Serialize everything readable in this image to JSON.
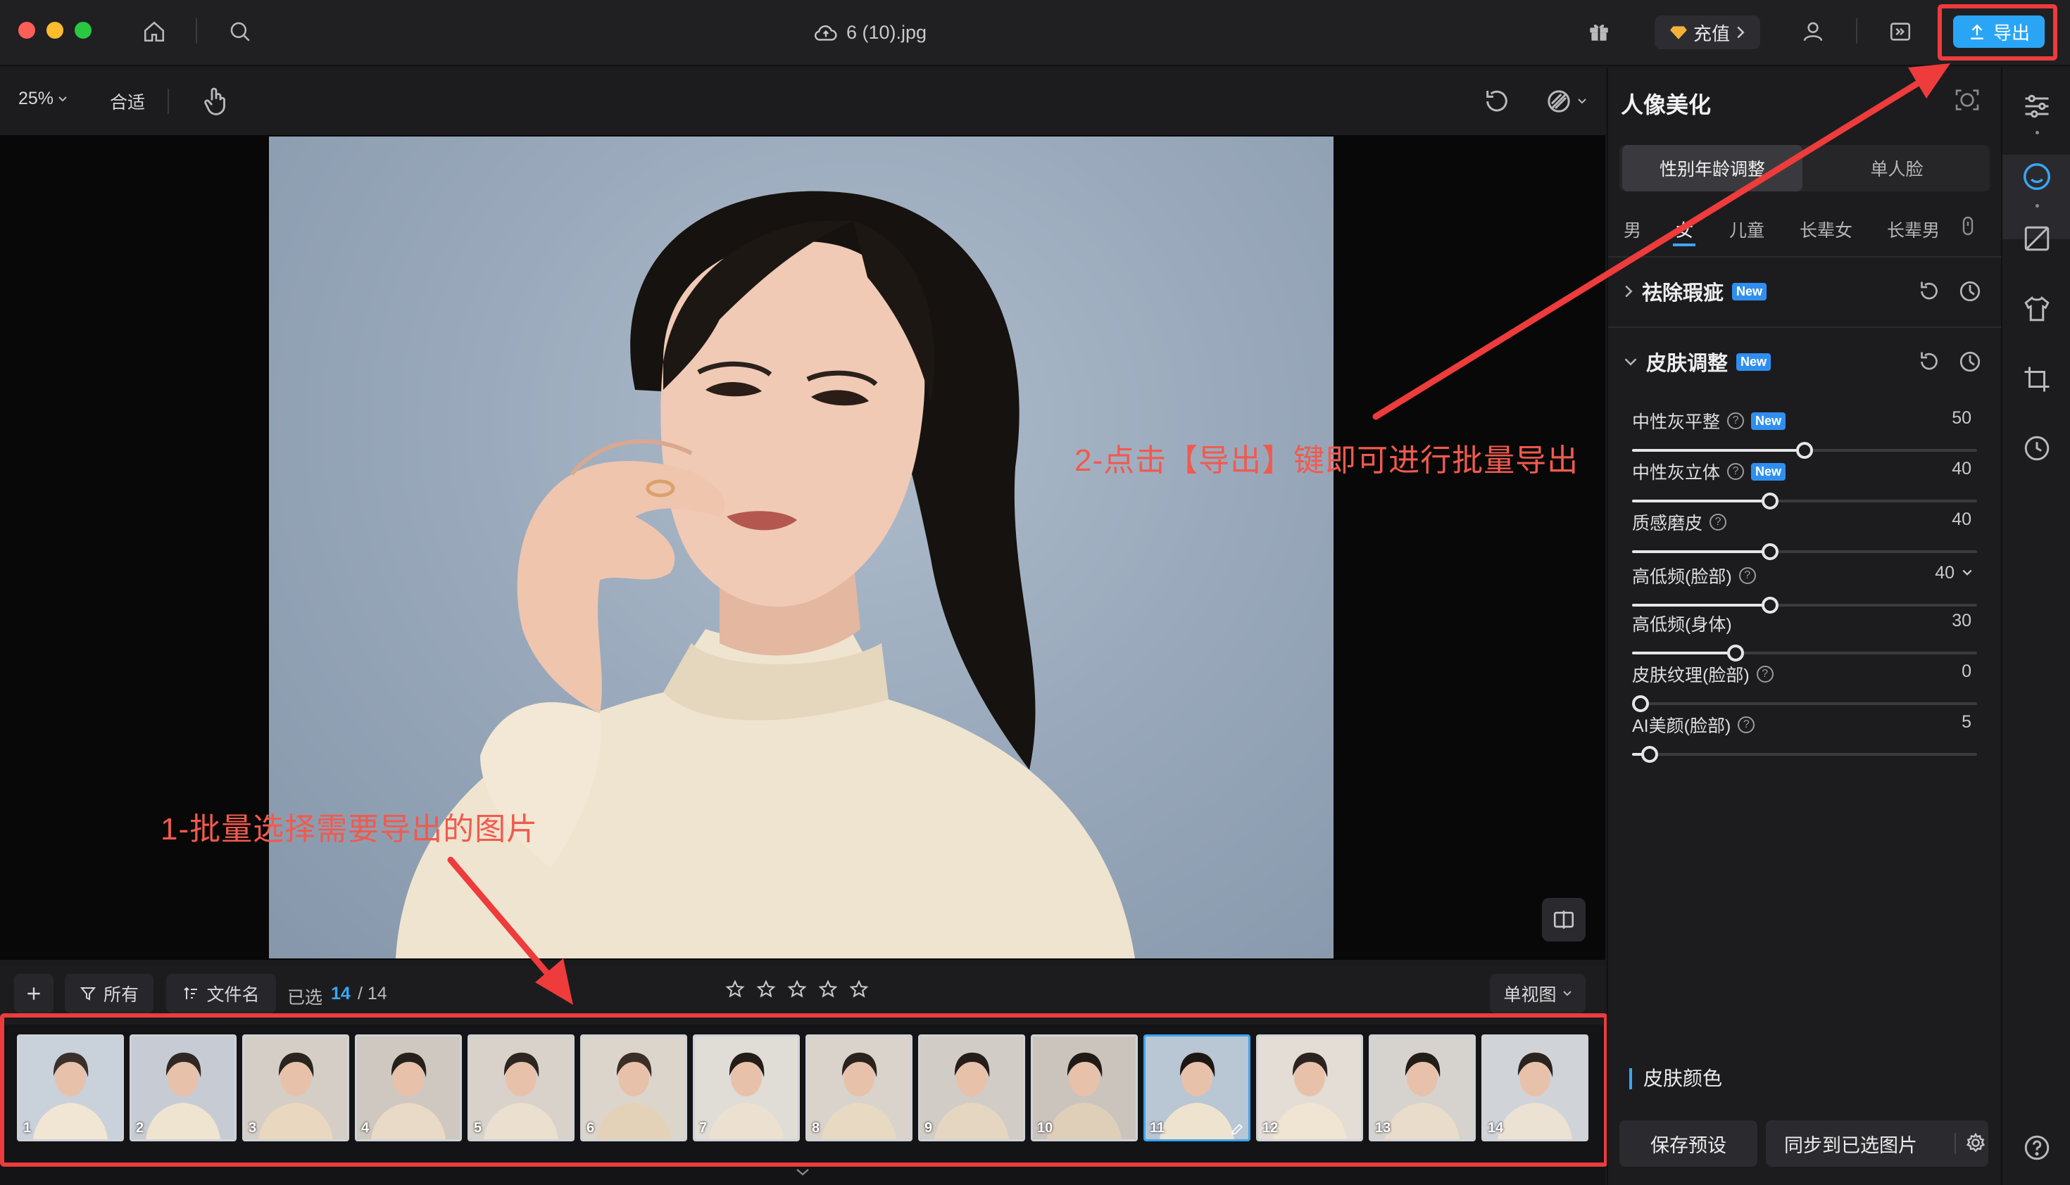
{
  "window": {
    "file_name": "6 (10).jpg",
    "recharge_label": "充值",
    "export_label": "导出"
  },
  "toolbar": {
    "zoom": "25%",
    "fit_label": "合适"
  },
  "filmstrip_bar": {
    "filter_label": "所有",
    "sort_label": "文件名",
    "selected_label": "已选",
    "selected_count": "14",
    "selected_total": "/ 14",
    "view_label": "单视图"
  },
  "thumbnails": [
    "1",
    "2",
    "3",
    "4",
    "5",
    "6",
    "7",
    "8",
    "9",
    "10",
    "11",
    "12",
    "13",
    "14"
  ],
  "active_thumbnail": "11",
  "panel": {
    "title": "人像美化",
    "tabs": [
      "性别年龄调整",
      "单人脸"
    ],
    "subtabs": [
      "男",
      "女",
      "儿童",
      "长辈女",
      "长辈男"
    ],
    "sections": {
      "blemish": "祛除瑕疵",
      "skin": "皮肤调整",
      "new_badge": "New"
    },
    "sliders": [
      {
        "label": "中性灰平整",
        "value": "50",
        "fraction": 0.5,
        "help": true,
        "badge": true
      },
      {
        "label": "中性灰立体",
        "value": "40",
        "fraction": 0.4,
        "help": true,
        "badge": true
      },
      {
        "label": "质感磨皮",
        "value": "40",
        "fraction": 0.4,
        "help": true,
        "badge": false
      },
      {
        "label": "高低频(脸部)",
        "value": "40",
        "fraction": 0.4,
        "help": true,
        "badge": false
      },
      {
        "label": "高低频(身体)",
        "value": "30",
        "fraction": 0.3,
        "help": false,
        "badge": false
      },
      {
        "label": "皮肤纹理(脸部)",
        "value": "0",
        "fraction": 0.0,
        "help": true,
        "badge": false
      },
      {
        "label": "AI美颜(脸部)",
        "value": "5",
        "fraction": 0.05,
        "help": true,
        "badge": false
      }
    ],
    "skin_color_label": "皮肤颜色",
    "save_preset_label": "保存预设",
    "sync_label": "同步到已选图片"
  },
  "annotations": {
    "step1": "1-批量选择需要导出的图片",
    "step2": "2-点击【导出】键即可进行批量导出"
  },
  "colors": {
    "accent": "#2aa5f5",
    "annotation": "#ee3b3b"
  }
}
